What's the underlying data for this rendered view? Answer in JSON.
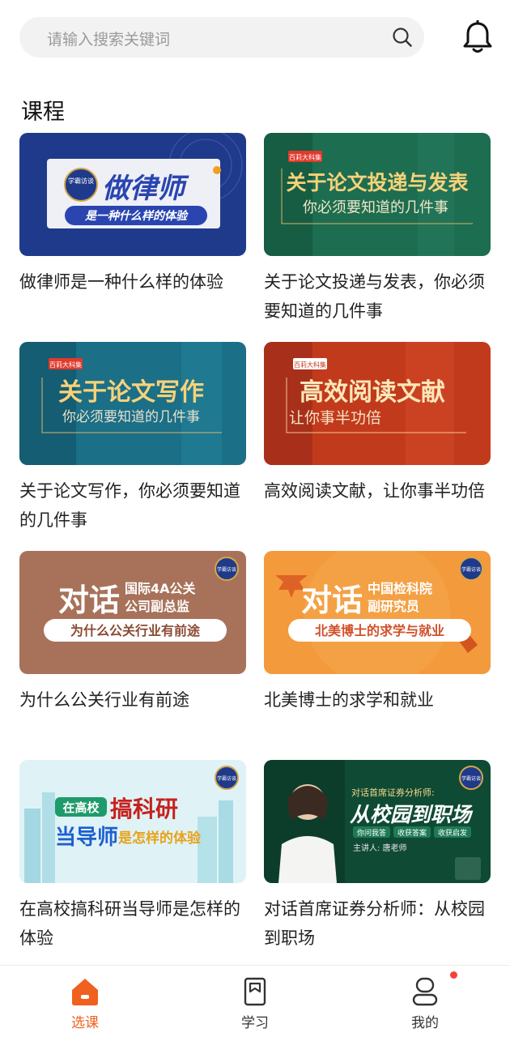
{
  "search": {
    "placeholder": "请输入搜索关键词",
    "icon": "search-icon"
  },
  "header": {
    "notification_icon": "bell-icon"
  },
  "section": {
    "title": "课程"
  },
  "courses": [
    {
      "title": "做律师是一种什么样的体验",
      "thumb": {
        "badge": "学霸访谈",
        "headline": "做律师",
        "sub": "是一种什么样的体验"
      }
    },
    {
      "title": "关于论文投递与发表，你必须要知道的几件事",
      "thumb": {
        "badge": "百莉大科集",
        "headline": "关于论文投递与发表",
        "sub": "你必须要知道的几件事"
      }
    },
    {
      "title": "关于论文写作，你必须要知道的几件事",
      "thumb": {
        "badge": "百莉大科集",
        "headline": "关于论文写作",
        "sub": "你必须要知道的几件事"
      }
    },
    {
      "title": "高效阅读文献，让你事半功倍",
      "thumb": {
        "badge": "百莉大科集",
        "headline": "高效阅读文献",
        "sub": "让你事半功倍"
      }
    },
    {
      "title": "为什么公关行业有前途",
      "thumb": {
        "badge": "学霸访谈",
        "headline": "对话",
        "side1": "国际4A公关",
        "side2": "公司副总监",
        "sub": "为什么公关行业有前途"
      }
    },
    {
      "title": "北美博士的求学和就业",
      "thumb": {
        "badge": "学霸访谈",
        "headline": "对话",
        "side1": "中国检科院",
        "side2": "副研究员",
        "sub": "北美博士的求学与就业"
      }
    },
    {
      "title": "在高校搞科研当导师是怎样的体验",
      "thumb": {
        "badge": "学霸访谈",
        "tag": "在高校",
        "headline": "搞科研",
        "line2a": "当导师",
        "line2b": "是怎样的体验"
      }
    },
    {
      "title": "对话首席证券分析师：从校园到职场",
      "thumb": {
        "badge": "学霸访谈",
        "top": "对话首席证券分析师:",
        "headline": "从校园到职场",
        "chips": [
          "你问我答",
          "收获答案",
          "收获启发"
        ],
        "speaker": "主讲人: 唐老师"
      }
    }
  ],
  "tabbar": {
    "tabs": [
      {
        "label": "选课",
        "icon": "home-icon",
        "active": true
      },
      {
        "label": "学习",
        "icon": "book-icon",
        "active": false
      },
      {
        "label": "我的",
        "icon": "profile-icon",
        "active": false
      }
    ]
  },
  "colors": {
    "accent": "#f0601e",
    "badge": "#f2433b"
  }
}
